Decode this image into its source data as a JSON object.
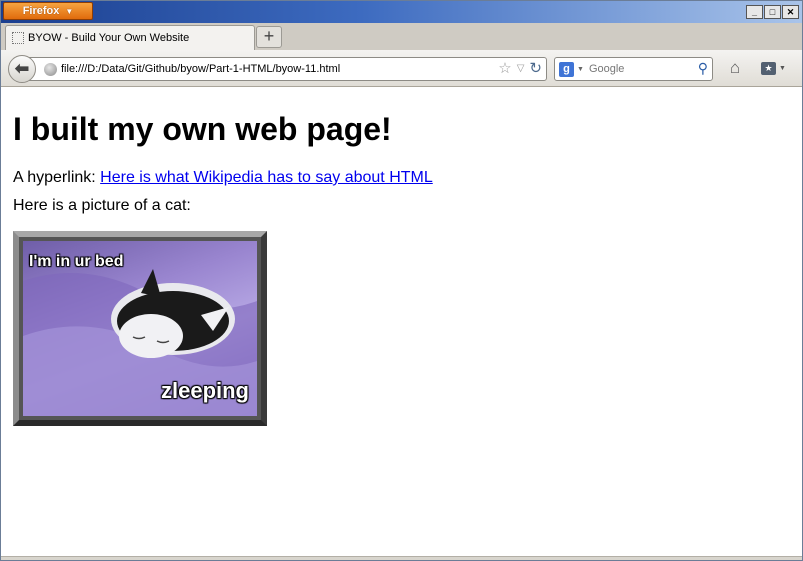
{
  "titlebar": {
    "app_button": "Firefox"
  },
  "tabs": [
    {
      "label": "BYOW - Build Your Own Website"
    }
  ],
  "newtab_label": "+",
  "urlbar": {
    "url": "file:///D:/Data/Git/Github/byow/Part-1-HTML/byow-11.html"
  },
  "search": {
    "engine_letter": "g",
    "placeholder": "Google"
  },
  "page": {
    "heading": "I built my own web page!",
    "hyperlink_prefix": "A hyperlink: ",
    "hyperlink_text": "Here is what Wikipedia has to say about HTML",
    "cat_intro": "Here is a picture of a cat:",
    "cat_caption_top": "I'm in ur bed",
    "cat_caption_bottom": "zleeping"
  },
  "colors": {
    "link": "#0000ee",
    "firefox_button": "#e98420",
    "titlebar": "#1b3f8f"
  },
  "icons": {
    "back": "back-arrow-icon",
    "globe": "globe-icon",
    "star": "star-icon",
    "reload": "reload-icon",
    "search": "magnifier-icon",
    "home": "home-icon",
    "bookmarks": "bookmarks-icon"
  }
}
